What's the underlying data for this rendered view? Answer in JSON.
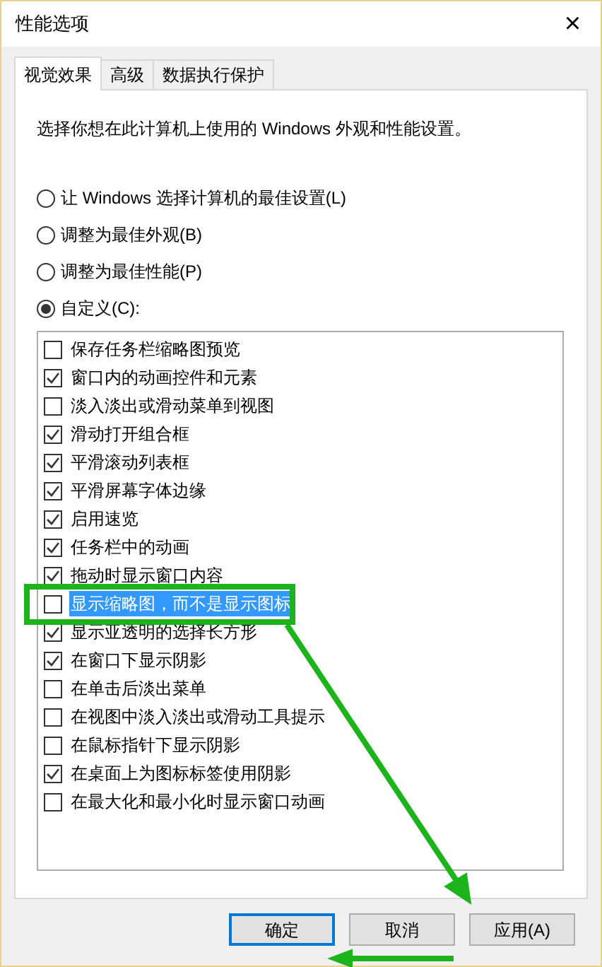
{
  "window": {
    "title": "性能选项",
    "close": "×"
  },
  "tabs": [
    {
      "label": "视觉效果",
      "selected": true
    },
    {
      "label": "高级",
      "selected": false
    },
    {
      "label": "数据执行保护",
      "selected": false
    }
  ],
  "description": "选择你想在此计算机上使用的 Windows 外观和性能设置。",
  "options": [
    {
      "label": "让 Windows 选择计算机的最佳设置(L)",
      "selected": false
    },
    {
      "label": "调整为最佳外观(B)",
      "selected": false
    },
    {
      "label": "调整为最佳性能(P)",
      "selected": false
    },
    {
      "label": "自定义(C):",
      "selected": true
    }
  ],
  "effects": [
    {
      "label": "保存任务栏缩略图预览",
      "checked": false,
      "selected": false
    },
    {
      "label": "窗口内的动画控件和元素",
      "checked": true,
      "selected": false
    },
    {
      "label": "淡入淡出或滑动菜单到视图",
      "checked": false,
      "selected": false
    },
    {
      "label": "滑动打开组合框",
      "checked": true,
      "selected": false
    },
    {
      "label": "平滑滚动列表框",
      "checked": true,
      "selected": false
    },
    {
      "label": "平滑屏幕字体边缘",
      "checked": true,
      "selected": false
    },
    {
      "label": "启用速览",
      "checked": true,
      "selected": false
    },
    {
      "label": "任务栏中的动画",
      "checked": true,
      "selected": false
    },
    {
      "label": "拖动时显示窗口内容",
      "checked": true,
      "selected": false
    },
    {
      "label": "显示缩略图，而不是显示图标",
      "checked": false,
      "selected": true
    },
    {
      "label": "显示亚透明的选择长方形",
      "checked": true,
      "selected": false
    },
    {
      "label": "在窗口下显示阴影",
      "checked": true,
      "selected": false
    },
    {
      "label": "在单击后淡出菜单",
      "checked": false,
      "selected": false
    },
    {
      "label": "在视图中淡入淡出或滑动工具提示",
      "checked": false,
      "selected": false
    },
    {
      "label": "在鼠标指针下显示阴影",
      "checked": false,
      "selected": false
    },
    {
      "label": "在桌面上为图标标签使用阴影",
      "checked": true,
      "selected": false
    },
    {
      "label": "在最大化和最小化时显示窗口动画",
      "checked": false,
      "selected": false
    }
  ],
  "buttons": [
    {
      "label": "确定",
      "selected": true
    },
    {
      "label": "取消",
      "selected": false
    },
    {
      "label": "应用(A)",
      "selected": false
    }
  ]
}
